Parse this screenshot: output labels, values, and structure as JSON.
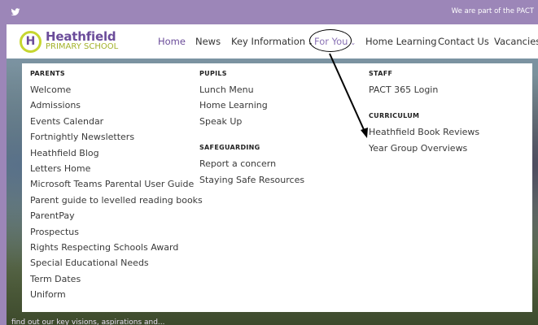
{
  "topbar": {
    "twitter_icon": "twitter-icon",
    "pact_text": "We are part of the PACT"
  },
  "logo": {
    "mark": "H",
    "name": "Heathfield",
    "subtitle": "PRIMARY SCHOOL"
  },
  "nav": {
    "home": "Home",
    "news": "News",
    "key_information": "Key Information",
    "for_you": "For You",
    "home_learning": "Home Learning",
    "contact_us": "Contact Us",
    "vacancies": "Vacancies"
  },
  "menu": {
    "parents": {
      "heading": "PARENTS",
      "items": [
        "Welcome",
        "Admissions",
        "Events Calendar",
        "Fortnightly Newsletters",
        "Heathfield Blog",
        "Letters Home",
        "Microsoft Teams Parental User Guide",
        "Parent guide to levelled reading books",
        "ParentPay",
        "Prospectus",
        "Rights Respecting Schools Award",
        "Special Educational Needs",
        "Term Dates",
        "Uniform"
      ]
    },
    "pupils": {
      "heading": "PUPILS",
      "items": [
        "Lunch Menu",
        "Home Learning",
        "Speak Up"
      ]
    },
    "safeguarding": {
      "heading": "SAFEGUARDING",
      "items": [
        "Report a concern",
        "Staying Safe Resources"
      ]
    },
    "staff": {
      "heading": "STAFF",
      "items": [
        "PACT 365 Login"
      ]
    },
    "curriculum": {
      "heading": "CURRICULUM",
      "items": [
        "Heathfield Book Reviews",
        "Year Group Overviews"
      ]
    }
  },
  "caption": "find out our key visions, aspirations and..."
}
